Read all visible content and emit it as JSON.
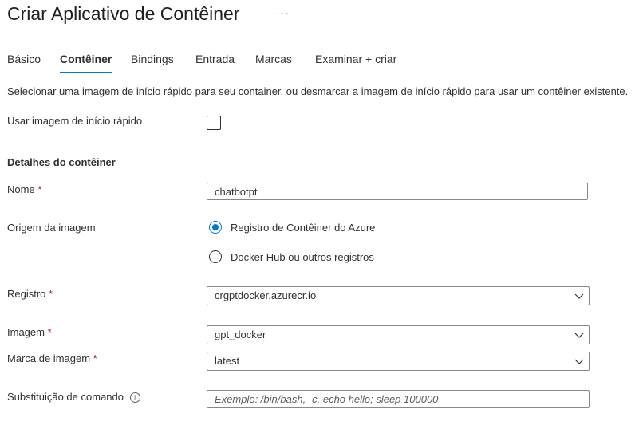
{
  "header": {
    "title": "Criar Aplicativo de Contêiner",
    "more_label": "···"
  },
  "tabs": [
    {
      "label": "Básico",
      "active": false
    },
    {
      "label": "Contêiner",
      "active": true
    },
    {
      "label": "Bindings",
      "active": false
    },
    {
      "label": "Entrada",
      "active": false
    },
    {
      "label": "Marcas",
      "active": false
    },
    {
      "label": "Examinar + criar",
      "active": false
    }
  ],
  "intro_text": "Selecionar uma imagem de início rápido para seu container, ou desmarcar a imagem de início rápido para usar um contêiner existente.",
  "quickstart": {
    "label": "Usar imagem de início rápido",
    "checked": false
  },
  "details": {
    "section_title": "Detalhes do contêiner",
    "required_mark": "*",
    "name": {
      "label": "Nome",
      "value": "chatbotpt"
    },
    "image_source": {
      "label": "Origem da imagem",
      "options": [
        {
          "label": "Registro de Contêiner do Azure",
          "selected": true
        },
        {
          "label": "Docker Hub ou outros registros",
          "selected": false
        }
      ]
    },
    "registry": {
      "label": "Registro",
      "value": "crgptdocker.azurecr.io"
    },
    "image": {
      "label": "Imagem",
      "value": "gpt_docker"
    },
    "image_tag": {
      "label": "Marca de imagem",
      "value": "latest"
    },
    "command_override": {
      "label": "Substituição de comando",
      "info_icon": "info-icon",
      "info_glyph": "i",
      "placeholder": "Exemplo: /bin/bash, -c, echo hello; sleep 100000"
    }
  },
  "colors": {
    "accent": "#0078d4",
    "required": "#a4262c",
    "text": "#323130",
    "border": "#8a8886"
  }
}
